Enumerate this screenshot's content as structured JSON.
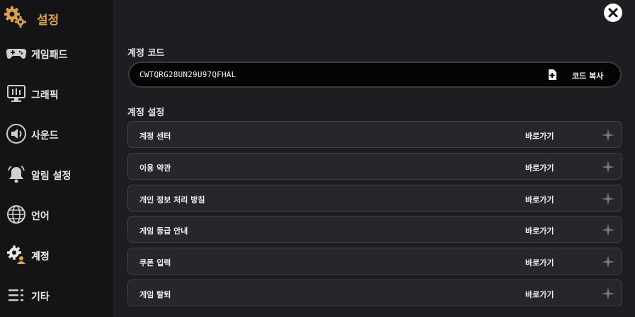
{
  "header": {
    "title": "설정"
  },
  "sidebar": {
    "items": [
      {
        "label": "게임패드",
        "icon": "gamepad-icon"
      },
      {
        "label": "그래픽",
        "icon": "monitor-icon"
      },
      {
        "label": "사운드",
        "icon": "speaker-icon"
      },
      {
        "label": "알림 설정",
        "icon": "bell-icon"
      },
      {
        "label": "언어",
        "icon": "globe-icon"
      },
      {
        "label": "계정",
        "icon": "account-gear-icon",
        "active": true
      },
      {
        "label": "기타",
        "icon": "list-icon"
      }
    ]
  },
  "account_code": {
    "section_title": "계정 코드",
    "code": "CWTQRG28UN29U97QFHAL",
    "copy_label": "코드 복사"
  },
  "account_settings": {
    "section_title": "계정 설정",
    "rows": [
      {
        "label": "계정 센터",
        "action": "바로가기"
      },
      {
        "label": "이용 약관",
        "action": "바로가기"
      },
      {
        "label": "개인 정보 처리 방침",
        "action": "바로가기"
      },
      {
        "label": "게임 등급 안내",
        "action": "바로가기"
      },
      {
        "label": "쿠폰 입력",
        "action": "바로가기"
      },
      {
        "label": "게임 탈퇴",
        "action": "바로가기"
      }
    ]
  },
  "colors": {
    "accent": "#d9a34a",
    "background": "#1e1e22",
    "sidebar": "#141416"
  }
}
